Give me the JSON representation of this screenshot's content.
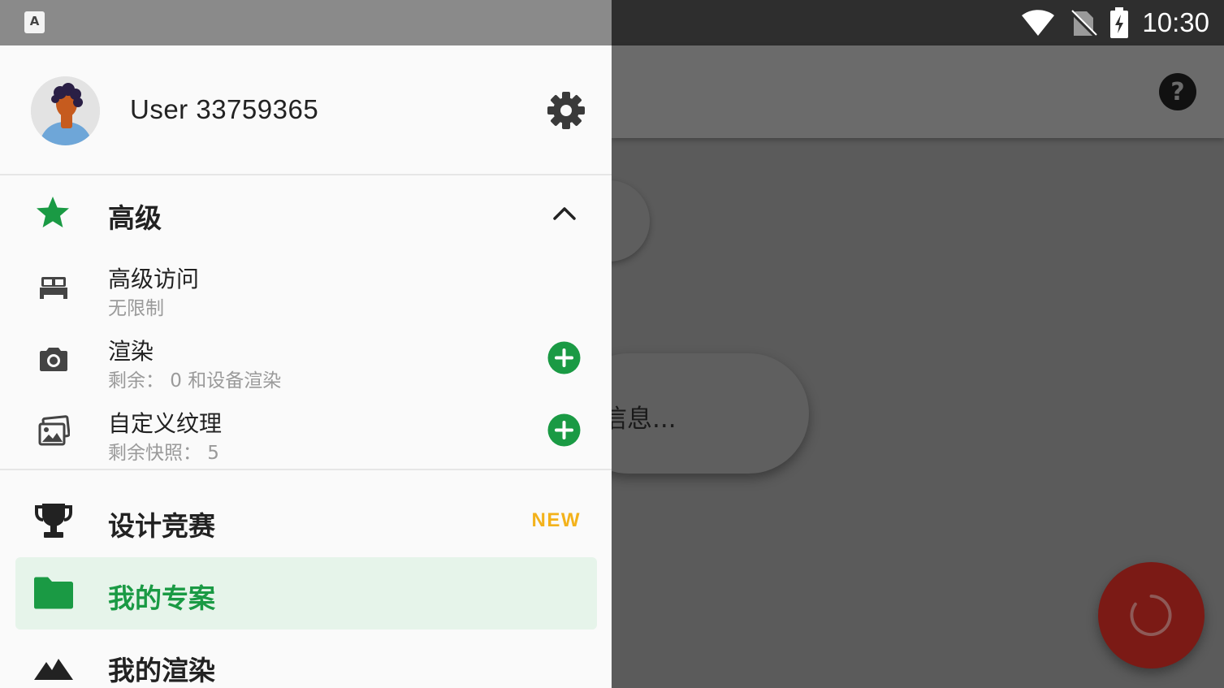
{
  "status_bar": {
    "time": "10:30",
    "icons": [
      "app-a-icon",
      "wifi-icon",
      "no-sim-icon",
      "battery-charging-icon"
    ]
  },
  "background": {
    "help_icon": "help-icon",
    "card_text": "信息..."
  },
  "drawer": {
    "user": {
      "name": "User 33759365"
    },
    "premium": {
      "title": "高级",
      "items": [
        {
          "label": "高级访问",
          "desc": "无限制",
          "icon": "bed-icon"
        },
        {
          "label": "渲染",
          "desc": "剩余： 0 和设备渲染",
          "icon": "camera-icon"
        },
        {
          "label": "自定义纹理",
          "desc": "剩余快照： 5",
          "icon": "texture-photos-icon"
        }
      ]
    },
    "nav": [
      {
        "label": "设计竞赛",
        "badge": "NEW",
        "icon": "trophy-icon"
      },
      {
        "label": "我的专案",
        "icon": "folder-icon",
        "selected": true
      },
      {
        "label": "我的渲染",
        "icon": "mountains-icon"
      }
    ]
  },
  "colors": {
    "accent_green": "#1a9a44",
    "badge_yellow": "#f3b21b",
    "fab_red": "#7b1a15",
    "selected_bg": "#e6f4ea"
  }
}
